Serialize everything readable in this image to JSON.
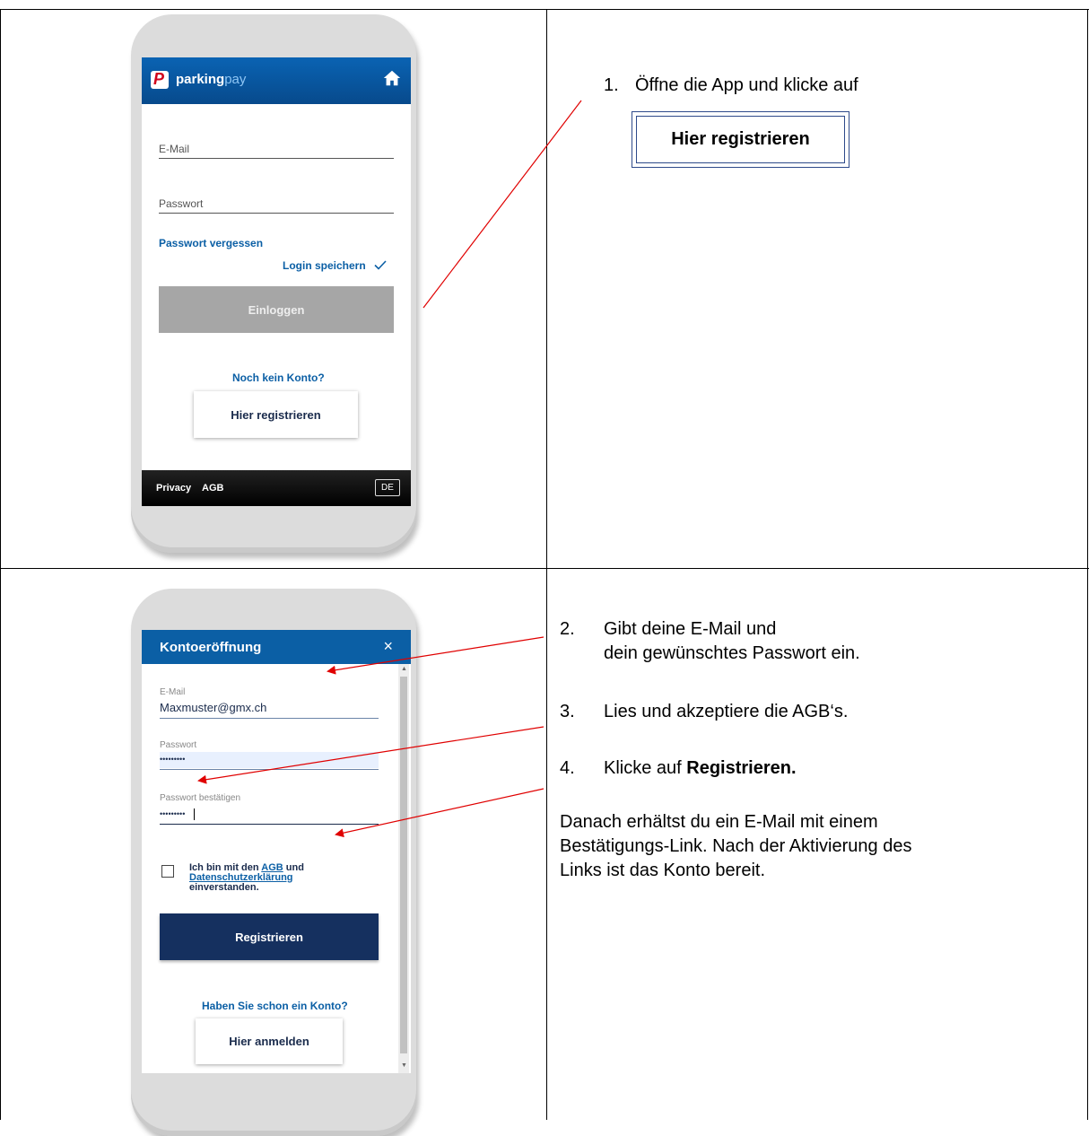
{
  "step1": {
    "app": {
      "brand_bold": "parking",
      "brand_light": "pay",
      "email_label": "E-Mail",
      "password_label": "Passwort",
      "forgot_link": "Passwort vergessen",
      "save_login": "Login speichern",
      "login_button": "Einloggen",
      "no_account": "Noch kein Konto?",
      "register_button": "Hier registrieren",
      "footer_privacy": "Privacy",
      "footer_agb": "AGB",
      "footer_lang": "DE"
    },
    "instruction_num": "1.",
    "instruction_text": "Öffne die App und klicke auf",
    "highlight_button": "Hier registrieren"
  },
  "step2": {
    "app": {
      "title": "Kontoeröffnung",
      "close": "×",
      "email_label": "E-Mail",
      "email_value": "Maxmuster@gmx.ch",
      "password_label": "Passwort",
      "password_value": "•••••••••",
      "confirm_label": "Passwort bestätigen",
      "confirm_value": "•••••••••",
      "terms_prefix": "Ich bin mit den ",
      "terms_agb": "AGB",
      "terms_and": " und",
      "terms_privacy": "Datenschutzerklärung",
      "terms_suffix": "einverstanden.",
      "register_button": "Registrieren",
      "have_account": "Haben Sie schon ein Konto?",
      "login_button": "Hier anmelden"
    },
    "items": [
      {
        "num": "2.",
        "line1": "Gibt deine E-Mail und",
        "line2": "dein gewünschtes Passwort ein."
      },
      {
        "num": "3.",
        "line1": "Lies und akzeptiere die AGB‘s."
      },
      {
        "num": "4.",
        "line1": "Klicke auf ",
        "bold": "Registrieren."
      }
    ],
    "note_lines": [
      "Danach erhältst du ein E-Mail mit einem",
      "Bestätigungs-Link. Nach der Aktivierung des",
      "Links ist das Konto bereit."
    ]
  },
  "colors": {
    "arrow": "#e00000",
    "brand_blue": "#0b5fa5",
    "navy": "#15305f"
  }
}
